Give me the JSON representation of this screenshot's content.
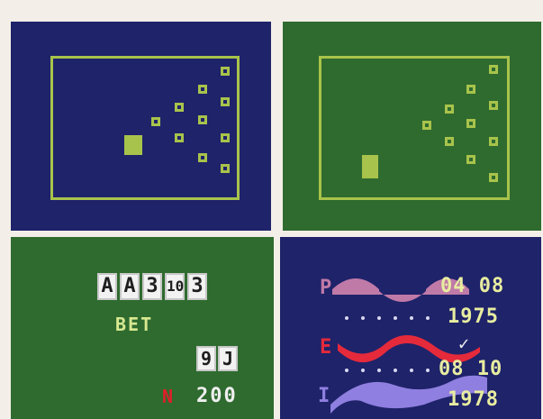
{
  "colors": {
    "navy": "#1f236a",
    "green_bg": "#2f6b2f",
    "lime": "#a8c34b",
    "red": "#e01f2a",
    "pink": "#c07aa8",
    "lavender": "#8f7fe0",
    "bright_red": "#e52a3b"
  },
  "bowling": {
    "left_panel": {
      "icon": "bowling-lane"
    },
    "right_panel": {
      "icon": "bowling-lane"
    }
  },
  "casino": {
    "cards": [
      "A",
      "A",
      "3",
      "10",
      "3"
    ],
    "bet_label": "BET",
    "bet_cards": [
      "9",
      "J"
    ],
    "money_symbol": "N",
    "money": "200"
  },
  "biorhythm": {
    "letters": {
      "p": "P",
      "e": "E",
      "i": "I"
    },
    "date1_day": "04",
    "date1_month": "08",
    "date1_year": "1975",
    "check": "✓",
    "date2_day": "08",
    "date2_month": "10",
    "date2_year": "1978"
  }
}
